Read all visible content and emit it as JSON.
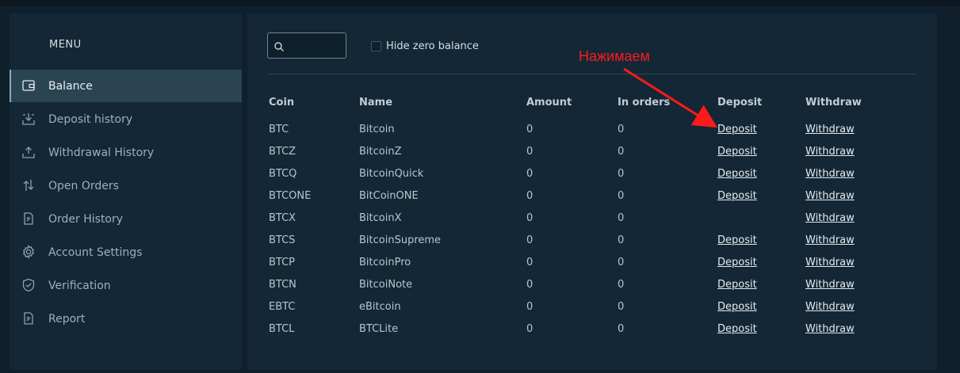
{
  "sidebar": {
    "menu_title": "MENU",
    "items": [
      {
        "label": "Balance",
        "icon": "wallet-icon",
        "active": true
      },
      {
        "label": "Deposit history",
        "icon": "deposit-tray-icon",
        "active": false
      },
      {
        "label": "Withdrawal History",
        "icon": "withdraw-tray-icon",
        "active": false
      },
      {
        "label": "Open Orders",
        "icon": "exchange-arrows-icon",
        "active": false
      },
      {
        "label": "Order History",
        "icon": "document-icon",
        "active": false
      },
      {
        "label": "Account Settings",
        "icon": "gear-icon",
        "active": false
      },
      {
        "label": "Verification",
        "icon": "shield-check-icon",
        "active": false
      },
      {
        "label": "Report",
        "icon": "report-icon",
        "active": false
      }
    ]
  },
  "toolbar": {
    "search_value": "",
    "search_placeholder": "",
    "hide_zero_label": "Hide zero balance",
    "hide_zero_checked": false
  },
  "annotation": {
    "text": "Нажимаем",
    "color": "#ff1a1a"
  },
  "table": {
    "headers": {
      "coin": "Coin",
      "name": "Name",
      "amount": "Amount",
      "in_orders": "In orders",
      "deposit": "Deposit",
      "withdraw": "Withdraw"
    },
    "rows": [
      {
        "coin": "BTC",
        "name": "Bitcoin",
        "amount": "0",
        "in_orders": "0",
        "deposit": "Deposit",
        "withdraw": "Withdraw"
      },
      {
        "coin": "BTCZ",
        "name": "BitcoinZ",
        "amount": "0",
        "in_orders": "0",
        "deposit": "Deposit",
        "withdraw": "Withdraw"
      },
      {
        "coin": "BTCQ",
        "name": "BitcoinQuick",
        "amount": "0",
        "in_orders": "0",
        "deposit": "Deposit",
        "withdraw": "Withdraw"
      },
      {
        "coin": "BTCONE",
        "name": "BitCoinONE",
        "amount": "0",
        "in_orders": "0",
        "deposit": "Deposit",
        "withdraw": "Withdraw"
      },
      {
        "coin": "BTCX",
        "name": "BitcoinX",
        "amount": "0",
        "in_orders": "0",
        "deposit": "",
        "withdraw": "Withdraw"
      },
      {
        "coin": "BTCS",
        "name": "BitcoinSupreme",
        "amount": "0",
        "in_orders": "0",
        "deposit": "Deposit",
        "withdraw": "Withdraw"
      },
      {
        "coin": "BTCP",
        "name": "BitcoinPro",
        "amount": "0",
        "in_orders": "0",
        "deposit": "Deposit",
        "withdraw": "Withdraw"
      },
      {
        "coin": "BTCN",
        "name": "BitcoiNote",
        "amount": "0",
        "in_orders": "0",
        "deposit": "Deposit",
        "withdraw": "Withdraw"
      },
      {
        "coin": "EBTC",
        "name": "eBitcoin",
        "amount": "0",
        "in_orders": "0",
        "deposit": "Deposit",
        "withdraw": "Withdraw"
      },
      {
        "coin": "BTCL",
        "name": "BTCLite",
        "amount": "0",
        "in_orders": "0",
        "deposit": "Deposit",
        "withdraw": "Withdraw"
      }
    ]
  }
}
